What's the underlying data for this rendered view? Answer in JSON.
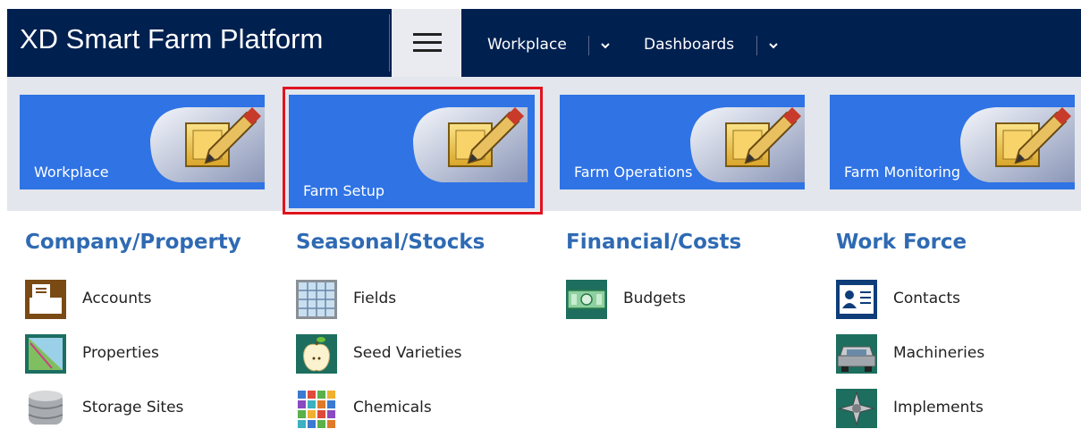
{
  "header": {
    "app_title": "XD Smart Farm Platform",
    "menu_button": "menu-icon",
    "nav": [
      {
        "label": "Workplace"
      },
      {
        "label": "Dashboards"
      }
    ]
  },
  "tiles": [
    {
      "label": "Workplace"
    },
    {
      "label": "Farm Setup",
      "selected": true
    },
    {
      "label": "Farm Operations"
    },
    {
      "label": "Farm Monitoring"
    }
  ],
  "colors": {
    "header_bg": "#002050",
    "tile_bg": "#2f73e5",
    "section_title": "#2f6ab3",
    "selection_border": "#e0131f"
  },
  "sections": [
    {
      "title": "Company/Property",
      "items": [
        {
          "label": "Accounts",
          "icon": "accounts-icon"
        },
        {
          "label": "Properties",
          "icon": "properties-map-icon"
        },
        {
          "label": "Storage Sites",
          "icon": "storage-database-icon"
        }
      ]
    },
    {
      "title": "Seasonal/Stocks",
      "items": [
        {
          "label": "Fields",
          "icon": "fields-grid-icon"
        },
        {
          "label": "Seed Varieties",
          "icon": "apple-icon"
        },
        {
          "label": "Chemicals",
          "icon": "chemicals-grid-icon"
        }
      ]
    },
    {
      "title": "Financial/Costs",
      "items": [
        {
          "label": "Budgets",
          "icon": "money-icon"
        }
      ]
    },
    {
      "title": "Work Force",
      "items": [
        {
          "label": "Contacts",
          "icon": "contact-card-icon"
        },
        {
          "label": "Machineries",
          "icon": "car-icon"
        },
        {
          "label": "Implements",
          "icon": "implement-tool-icon"
        }
      ]
    }
  ]
}
